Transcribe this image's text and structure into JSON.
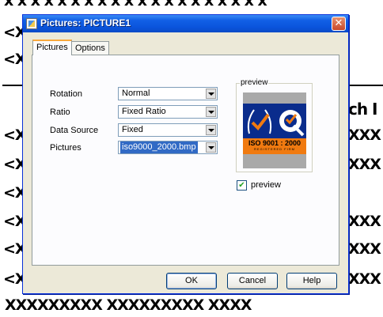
{
  "document": {
    "lines": [
      "x x x x x x x x x x x x x x x x x x x x",
      "<X",
      "<X",
      "ch I",
      "<X",
      "<X",
      "<X",
      "<X",
      "<X",
      "<X",
      "XXX",
      "XXX",
      "XXX",
      "XXX",
      "XXX",
      "XXXXXXXXX XXXXXXXXX   XXXX"
    ]
  },
  "dialog": {
    "title": "Pictures: PICTURE1",
    "close_symbol": "✕",
    "tabs": [
      {
        "label": "Pictures",
        "active": true
      },
      {
        "label": "Options",
        "active": false
      }
    ],
    "fields": [
      {
        "label": "Rotation",
        "value": "Normal"
      },
      {
        "label": "Ratio",
        "value": "Fixed Ratio"
      },
      {
        "label": "Data Source",
        "value": "Fixed"
      },
      {
        "label": "Pictures",
        "value": "iso9000_2000.bmp"
      }
    ],
    "preview": {
      "group_label": "preview",
      "logo_text": "ISO 9001 : 2000",
      "logo_subtext": "REGISTERED FIRM",
      "checkbox_label": "preview",
      "checkbox_checked": true,
      "check_mark": "✔"
    },
    "buttons": {
      "ok": "OK",
      "cancel": "Cancel",
      "help": "Help"
    }
  },
  "colors": {
    "titlebar": "#0a54dc",
    "dialog_bg": "#ece9d8",
    "panel_bg": "#fcfcfe",
    "selection": "#316ac5",
    "logo_blue": "#0a2c8c",
    "logo_orange": "#f07a10"
  }
}
